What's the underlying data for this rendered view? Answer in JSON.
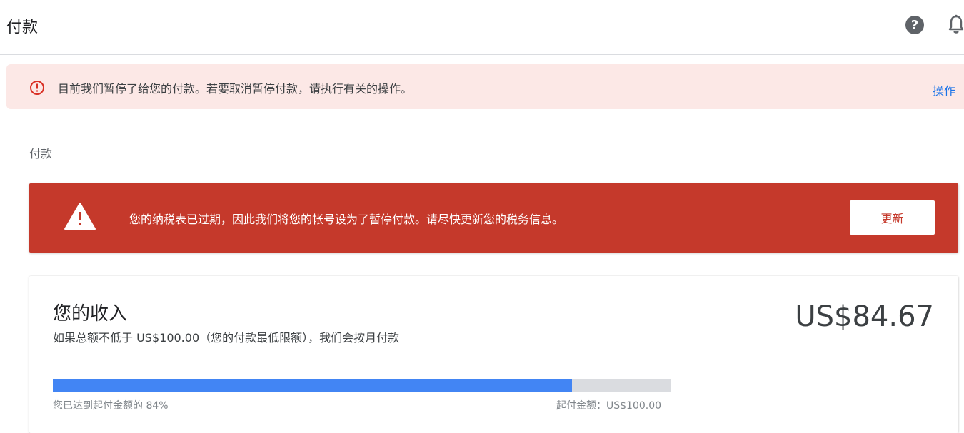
{
  "header": {
    "title": "付款",
    "icons": [
      "help-icon",
      "bell-icon"
    ]
  },
  "alert": {
    "icon": "error-outline-icon",
    "message": "目前我们暂停了给您的付款。若要取消暂停付款，请执行有关的操作。",
    "action_label": "操作",
    "accent_color": "#d93025",
    "action_color": "#1a73e8"
  },
  "breadcrumb": "付款",
  "tax_banner": {
    "icon": "warning-icon",
    "message": "您的纳税表已过期，因此我们将您的帐号设为了暂停付款。请尽快更新您的税务信息。",
    "update_label": "更新",
    "background_color": "#c5392b"
  },
  "earnings": {
    "title": "您的收入",
    "subtitle": "如果总额不低于 US$100.00（您的付款最低限额），我们会按月付款",
    "amount": "US$84.67",
    "progress": {
      "fraction": 0.84,
      "reached_label": "您已达到起付金额的 84%",
      "threshold_label": "起付金额：US$100.00",
      "fill_color": "#4285f4"
    }
  }
}
